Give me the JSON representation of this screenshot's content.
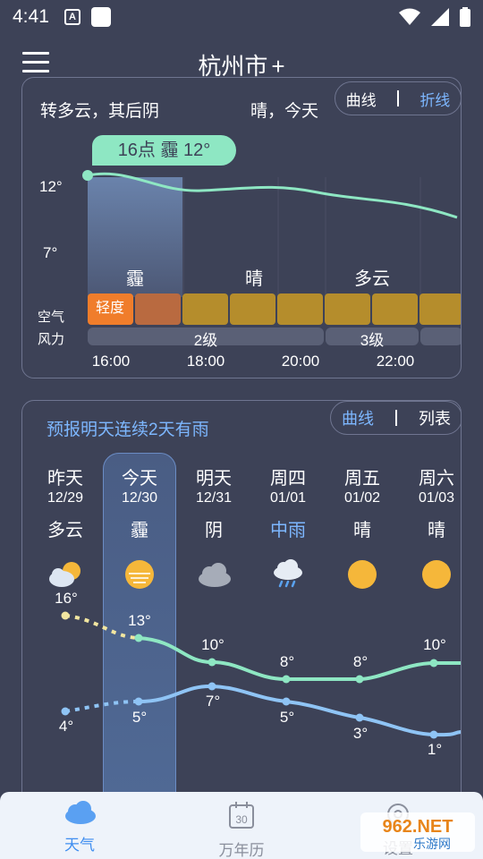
{
  "status_bar": {
    "time": "4:41",
    "a_icon": "A"
  },
  "header": {
    "city": "杭州市",
    "add_symbol": "+"
  },
  "hourly": {
    "summary_left": "转多云，其后阴",
    "summary_right": "晴，今天",
    "toggle": {
      "curve": "曲线",
      "line": "折线"
    },
    "tooltip": "16点 霾 12°",
    "temp_ticks": [
      "12°",
      "7°"
    ],
    "conditions": [
      "霾",
      "晴",
      "多云"
    ],
    "side_labels": {
      "air": "空气",
      "wind": "风力"
    },
    "aqi_label": "轻度",
    "aqi_colors": [
      "#f07d2b",
      "#b96a40",
      "#b58d2c"
    ],
    "wind": [
      "2级",
      "3级"
    ],
    "times": [
      "16:00",
      "18:00",
      "20:00",
      "22:00"
    ]
  },
  "daily": {
    "note": "预报明天连续2天有雨",
    "toggle": {
      "curve": "曲线",
      "list": "列表"
    },
    "days": [
      {
        "name": "昨天",
        "date": "12/29",
        "cond": "多云",
        "icon": "partly-cloudy-icon",
        "high": "16°",
        "low": "4°"
      },
      {
        "name": "今天",
        "date": "12/30",
        "cond": "霾",
        "icon": "haze-icon",
        "high": "13°",
        "low": "5°"
      },
      {
        "name": "明天",
        "date": "12/31",
        "cond": "阴",
        "icon": "overcast-icon",
        "high": "10°",
        "low": "7°"
      },
      {
        "name": "周四",
        "date": "01/01",
        "cond": "中雨",
        "icon": "rain-icon",
        "high": "8°",
        "low": "5°"
      },
      {
        "name": "周五",
        "date": "01/02",
        "cond": "晴",
        "icon": "sun-icon",
        "high": "8°",
        "low": "3°"
      },
      {
        "name": "周六",
        "date": "01/03",
        "cond": "晴",
        "icon": "sun-icon",
        "high": "10°",
        "low": "1°"
      }
    ]
  },
  "nav": {
    "weather": "天气",
    "calendar": "万年历",
    "calendar_day": "30",
    "third": "设置"
  },
  "watermark": {
    "text1": "962.NET",
    "text2": "乐游网"
  },
  "colors": {
    "accent": "#7db7ff",
    "high_line": "#8ee7c3",
    "low_line": "#8fc4f5",
    "bg": "#3d4257"
  }
}
